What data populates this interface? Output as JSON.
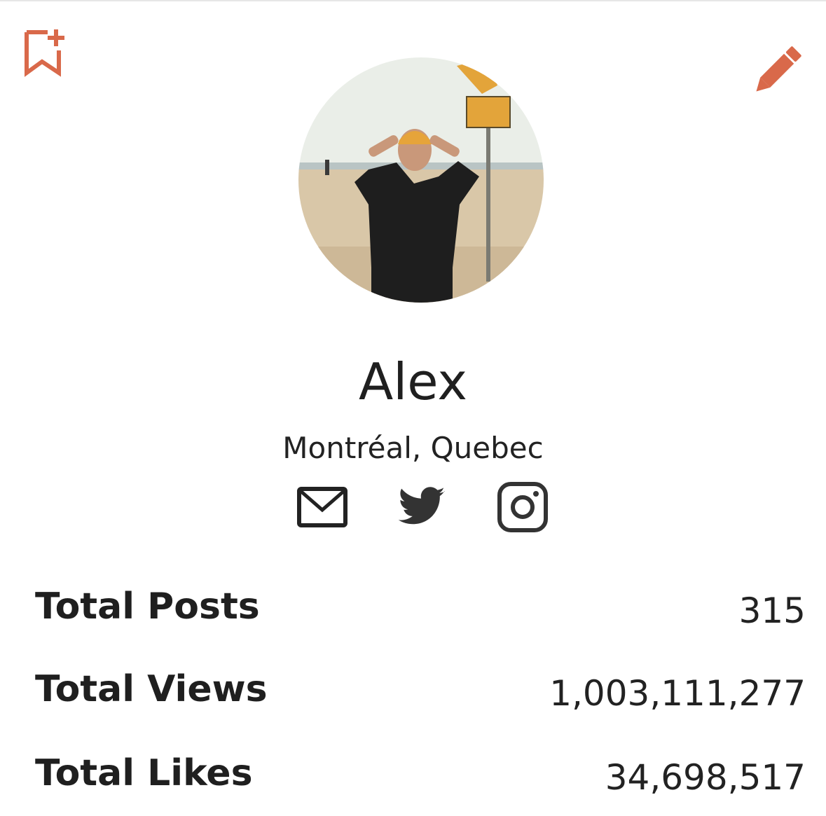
{
  "header": {
    "bookmark_icon": "bookmark-add-icon",
    "edit_icon": "pencil-icon",
    "accent_color": "#d9694a"
  },
  "profile": {
    "avatar_icon": "profile-photo",
    "name": "Alex",
    "location": "Montréal, Quebec"
  },
  "social": {
    "icons": [
      "mail-icon",
      "twitter-icon",
      "instagram-icon"
    ],
    "icon_color": "#333333"
  },
  "stats": [
    {
      "label": "Total Posts",
      "value": "315"
    },
    {
      "label": "Total Views",
      "value": "1,003,111,277"
    },
    {
      "label": "Total Likes",
      "value": "34,698,517"
    }
  ]
}
